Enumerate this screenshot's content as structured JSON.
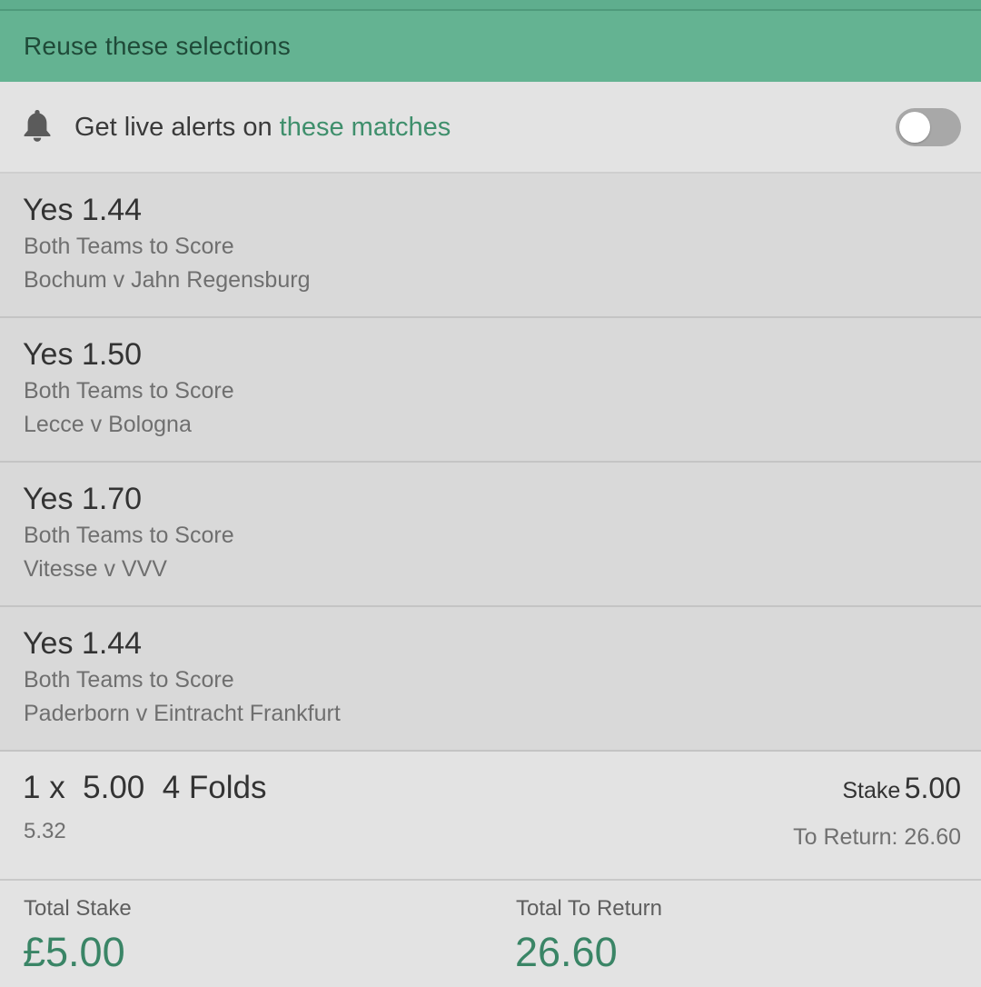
{
  "reuse_label": "Reuse these selections",
  "alerts": {
    "text": "Get live alerts on ",
    "link": "these matches",
    "toggle_on": false
  },
  "selections": [
    {
      "selection": "Yes",
      "odds": "1.44",
      "market": "Both Teams to Score",
      "event": "Bochum v Jahn Regensburg"
    },
    {
      "selection": "Yes",
      "odds": "1.50",
      "market": "Both Teams to Score",
      "event": "Lecce v Bologna"
    },
    {
      "selection": "Yes",
      "odds": "1.70",
      "market": "Both Teams to Score",
      "event": "Vitesse v VVV"
    },
    {
      "selection": "Yes",
      "odds": "1.44",
      "market": "Both Teams to Score",
      "event": "Paderborn v Eintracht Frankfurt"
    }
  ],
  "bet": {
    "description": "1 x  5.00  4 Folds",
    "odds": "5.32",
    "stake_label": "Stake",
    "stake_value": "5.00",
    "return_text": "To Return: 26.60"
  },
  "totals": {
    "stake_label": "Total Stake",
    "stake_value": "£5.00",
    "return_label": "Total To Return",
    "return_value": "26.60"
  },
  "colors": {
    "header_green": "#64b392",
    "link_green": "#3f8f6c",
    "total_green": "#3a8566"
  }
}
